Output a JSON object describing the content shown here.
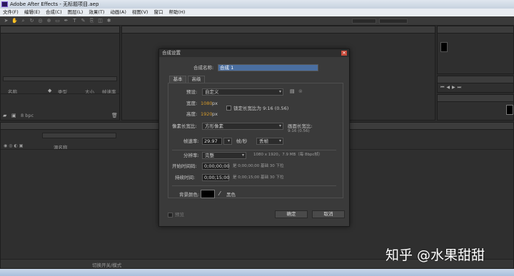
{
  "window": {
    "title": "Adobe After Effects - 无标题项目.aep"
  },
  "menu": [
    "文件(F)",
    "编辑(E)",
    "合成(C)",
    "图层(L)",
    "效果(T)",
    "动画(A)",
    "视图(V)",
    "窗口",
    "帮助(H)"
  ],
  "project_panel": {
    "col_name": "名称",
    "col_type": "类型",
    "col_size": "大小",
    "col_rate": "帧速率",
    "bpc": "8 bpc"
  },
  "timeline": {
    "col_source": "源名称",
    "bottom_label": "切换开关/模式"
  },
  "dialog": {
    "title": "合成设置",
    "comp_name_label": "合成名称:",
    "comp_name_value": "合成 1",
    "tabs": [
      "基本",
      "高级"
    ],
    "preset_label": "预设:",
    "preset_value": "自定义",
    "width_label": "宽度:",
    "width_value": "1080",
    "width_unit": "px",
    "height_label": "高度:",
    "height_value": "1920",
    "height_unit": "px",
    "lock_label": "锁定长宽比为 9:16 (0.56)",
    "pixel_aspect_label": "像素长宽比:",
    "pixel_aspect_value": "方形像素",
    "frame_aspect_label": "画面长宽比:",
    "frame_aspect_value": "9:16 (0.56)",
    "fps_label": "帧速率:",
    "fps_value": "29.97",
    "fps_unit": "帧/秒",
    "fps_mode": "丢帧",
    "resolution_label": "分辨率:",
    "resolution_value": "完整",
    "resolution_info": "1080 x 1920，7.9 MB（每 8bpc帧）",
    "start_label": "开始时间码:",
    "start_value": "0;00;00;00",
    "start_info": "是 0;00;00;00 基础 30 下拉",
    "duration_label": "持续时间:",
    "duration_value": "0;00;15;00",
    "duration_info": "是 0;00;15;00 基础 30 下拉",
    "bg_label": "背景颜色:",
    "bg_color_name": "黑色",
    "bg_color": "#000000",
    "preview_label": "预览",
    "ok_label": "确定",
    "cancel_label": "取消"
  },
  "watermark": "知乎 @水果甜甜"
}
